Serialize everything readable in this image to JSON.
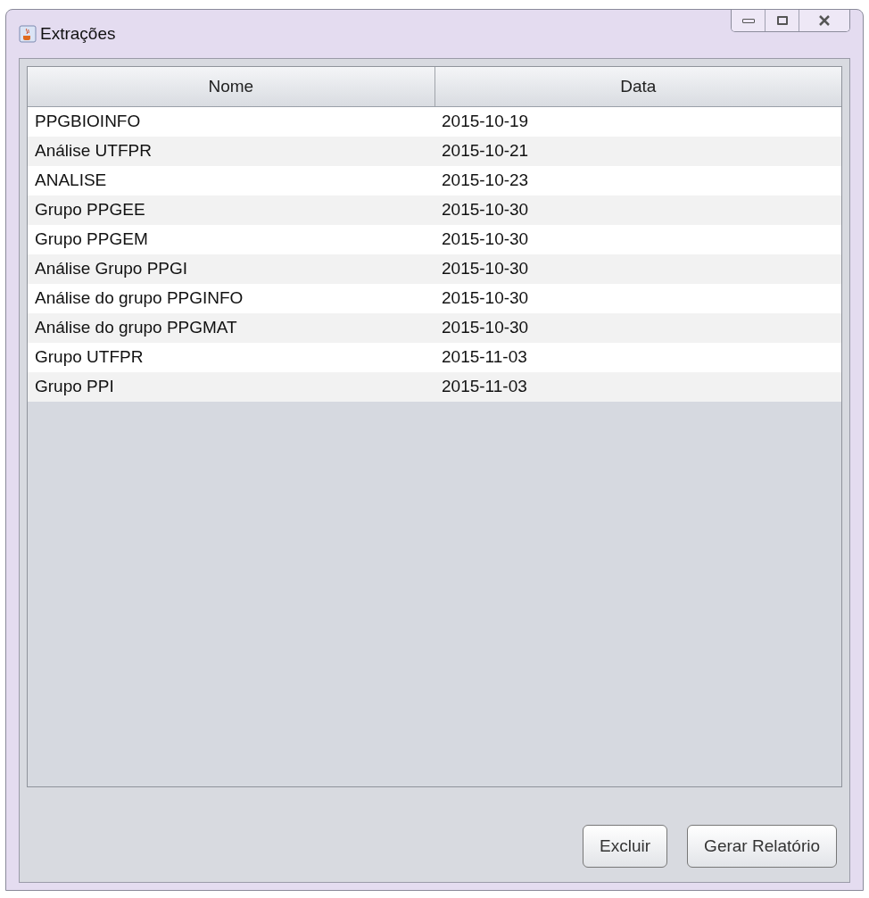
{
  "window": {
    "title": "Extrações"
  },
  "table": {
    "columns": [
      "Nome",
      "Data"
    ],
    "rows": [
      {
        "cells": [
          "PPGBIOINFO",
          "2015-10-19"
        ]
      },
      {
        "cells": [
          "Análise UTFPR",
          "2015-10-21"
        ]
      },
      {
        "cells": [
          "ANALISE",
          "2015-10-23"
        ]
      },
      {
        "cells": [
          "Grupo PPGEE",
          "2015-10-30"
        ]
      },
      {
        "cells": [
          "Grupo PPGEM",
          "2015-10-30"
        ]
      },
      {
        "cells": [
          "Análise Grupo PPGI",
          "2015-10-30"
        ]
      },
      {
        "cells": [
          "Análise do grupo PPGINFO",
          "2015-10-30"
        ]
      },
      {
        "cells": [
          "Análise do grupo PPGMAT",
          "2015-10-30"
        ]
      },
      {
        "cells": [
          "Grupo UTFPR",
          "2015-11-03"
        ]
      },
      {
        "cells": [
          "Grupo PPI",
          "2015-11-03"
        ]
      }
    ]
  },
  "buttons": [
    "Excluir",
    "Gerar Relatório"
  ]
}
